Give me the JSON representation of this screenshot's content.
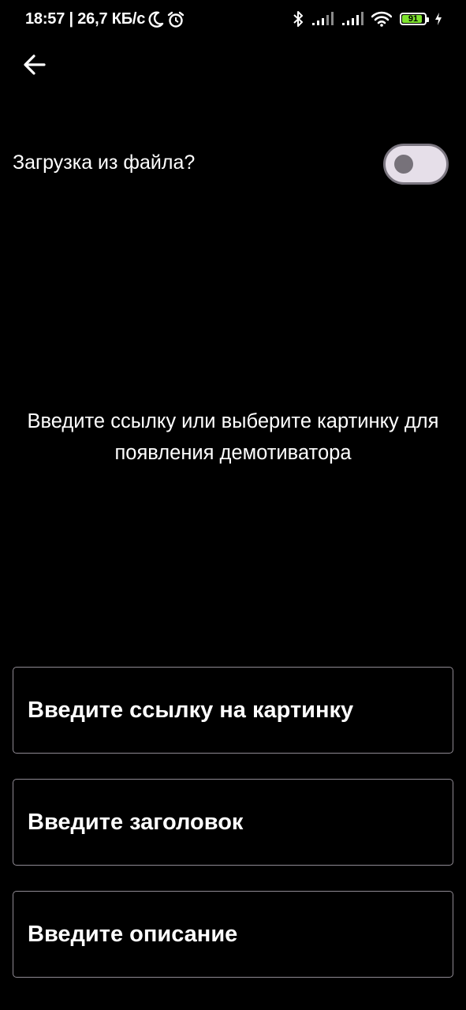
{
  "status_bar": {
    "time_and_speed": "18:57 | 26,7 КБ/с",
    "battery_level": "91",
    "battery_fill_fraction": 0.91,
    "battery_color": "#7ee32e",
    "icons": [
      "moon-icon",
      "alarm-icon",
      "bluetooth-icon",
      "signal-icon",
      "signal-icon",
      "wifi-icon",
      "battery-icon",
      "charging-icon"
    ]
  },
  "header": {
    "back_icon": "arrow-left-icon"
  },
  "toggle": {
    "label": "Загрузка из файла?",
    "checked": false
  },
  "hint": {
    "text": "Введите ссылку или выберите картинку для появления демотиватора"
  },
  "fields": {
    "image_url": {
      "placeholder": "Введите ссылку на картинку",
      "value": ""
    },
    "title": {
      "placeholder": "Введите заголовок",
      "value": ""
    },
    "description": {
      "placeholder": "Введите описание",
      "value": ""
    }
  }
}
